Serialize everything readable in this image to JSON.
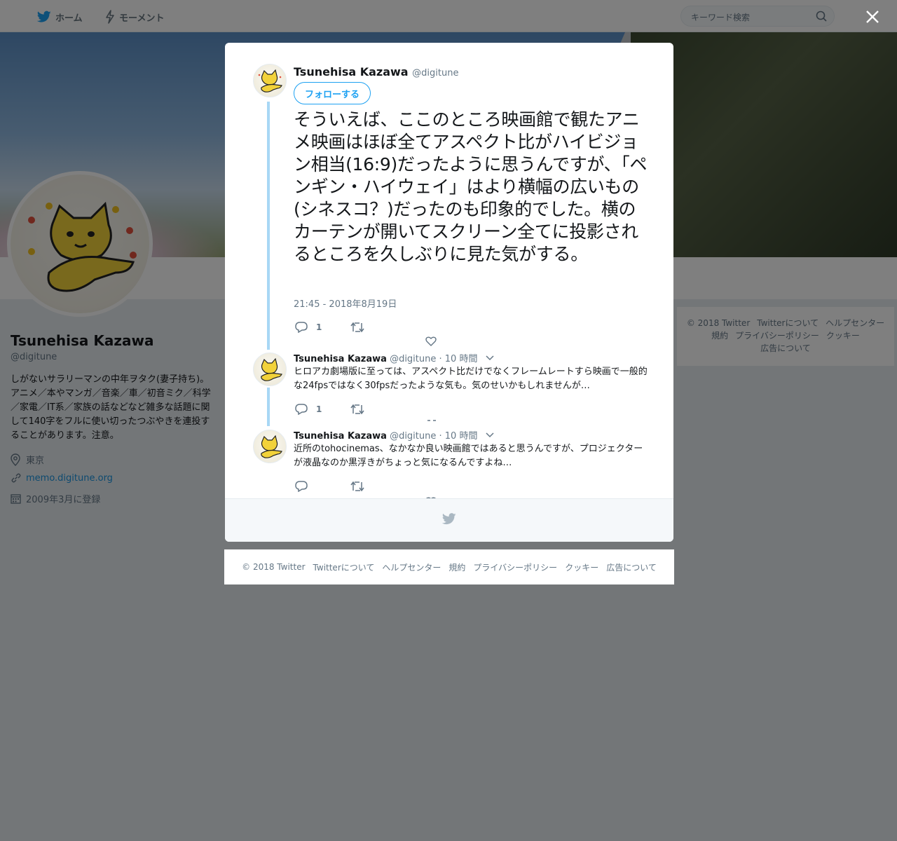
{
  "topbar": {
    "home_label": "ホーム",
    "moments_label": "モーメント",
    "search_placeholder": "キーワード検索"
  },
  "profile": {
    "name": "Tsunehisa Kazawa",
    "handle": "@digitune",
    "bio": "しがないサラリーマンの中年ヲタク(妻子持ち)。アニメ／本やマンガ／音楽／車／初音ミク／科学／家電／IT系／家族の話などなど雑多な話題に関して140字をフルに使い切ったつぶやきを連投することがあります。注意。",
    "location": "東京",
    "url": "memo.digitune.org",
    "joined": "2009年3月に登録"
  },
  "side_footer": {
    "items": [
      "© 2018 Twitter",
      "Twitterについて",
      "ヘルプセンター",
      "規約",
      "プライバシーポリシー",
      "クッキー",
      "広告について"
    ]
  },
  "modal": {
    "main_tweet": {
      "name": "Tsunehisa Kazawa",
      "handle": "@digitune",
      "follow_label": "フォローする",
      "text": "そういえば、ここのところ映画館で観たアニメ映画はほぼ全てアスペクト比がハイビジョン相当(16:9)だったように思うんですが、「ペンギン・ハイウェイ」はより横幅の広いもの(シネスコ？)だったのも印象的でした。横のカーテンが開いてスクリーン全てに投影されるところを久しぶりに見た気がする。",
      "timestamp": "21:45 - 2018年8月19日",
      "reply_count": "1"
    },
    "replies": [
      {
        "name": "Tsunehisa Kazawa",
        "handle": "@digitune",
        "time": "· 10 時間",
        "text": "ヒロアカ劇場版に至っては、アスペクト比だけでなくフレームレートすら映画で一般的な24fpsではなく30fpsだったような気も。気のせいかもしれませんが…",
        "reply_count": "1"
      },
      {
        "name": "Tsunehisa Kazawa",
        "handle": "@digitune",
        "time": "· 10 時間",
        "text": "近所のtohocinemas、なかなか良い映画館ではあると思うんですが、プロジェクターが液晶なのか黒浮きがちょっと気になるんですよね…",
        "reply_count": ""
      }
    ]
  },
  "modal_footer": {
    "items": [
      "© 2018 Twitter",
      "Twitterについて",
      "ヘルプセンター",
      "規約",
      "プライバシーポリシー",
      "クッキー",
      "広告について"
    ]
  },
  "colors": {
    "accent": "#1da1f2",
    "thread_line": "#a8d7f5",
    "secondary_text": "#657786"
  }
}
